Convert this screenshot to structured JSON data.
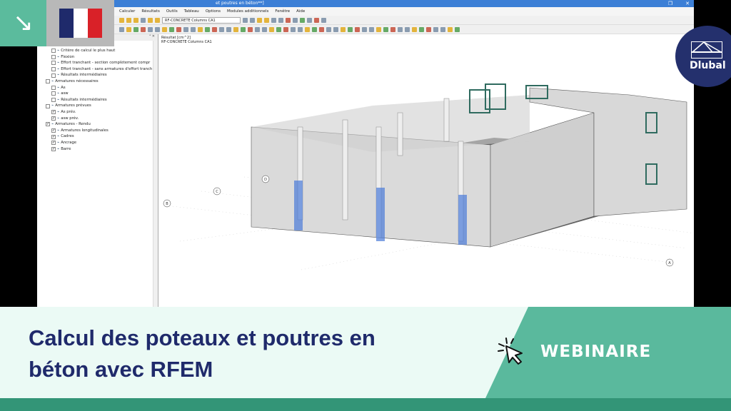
{
  "window": {
    "title": "et poutres en béton**]",
    "menu": [
      "Calculer",
      "Résultats",
      "Outils",
      "Tableau",
      "Options",
      "Modules additionnels",
      "Fenêtre",
      "Aide"
    ],
    "case_combo": "RF-CONCRETE Columns CA1"
  },
  "panel": {
    "items": [
      {
        "label": "Critère de calcul le plus haut",
        "checked": false,
        "indent": 2
      },
      {
        "label": "Flexion",
        "checked": false,
        "indent": 2
      },
      {
        "label": "Effort tranchant - section complètement compr",
        "checked": false,
        "indent": 2
      },
      {
        "label": "Effort tranchant - sans armatures d'effort tranch",
        "checked": false,
        "indent": 2
      },
      {
        "label": "Résultats intermédiaires",
        "checked": false,
        "indent": 2
      },
      {
        "label": "Armatures nécessaires",
        "checked": false,
        "indent": 1
      },
      {
        "label": "As",
        "checked": false,
        "indent": 2
      },
      {
        "label": "asw",
        "checked": false,
        "indent": 2
      },
      {
        "label": "Résultats intermédiaires",
        "checked": false,
        "indent": 2
      },
      {
        "label": "Armatures prévues",
        "checked": false,
        "indent": 1
      },
      {
        "label": "As prév.",
        "checked": true,
        "indent": 2
      },
      {
        "label": "asw prév.",
        "checked": true,
        "indent": 2
      },
      {
        "label": "Armatures - Rendu",
        "checked": true,
        "indent": 1
      },
      {
        "label": "Armatures longitudinales",
        "checked": true,
        "indent": 2
      },
      {
        "label": "Cadres",
        "checked": true,
        "indent": 2
      },
      {
        "label": "Ancrage",
        "checked": true,
        "indent": 2
      },
      {
        "label": "Barre",
        "checked": true,
        "indent": 2
      }
    ]
  },
  "view": {
    "result_label": "Résultat [cm^2]",
    "case_label": "RF-CONCRETE Columns CA1",
    "axes": [
      "A",
      "B",
      "C",
      "D"
    ]
  },
  "brand": {
    "name": "Dlubal"
  },
  "banner": {
    "title_line1": "Calcul des poteaux et poutres en",
    "title_line2": "béton avec RFEM",
    "tag": "WEBINAIRE"
  },
  "colors": {
    "navy": "#1f2a6b",
    "green": "#5ab99d",
    "dark_green": "#339577",
    "mint": "#ebfaf5"
  }
}
